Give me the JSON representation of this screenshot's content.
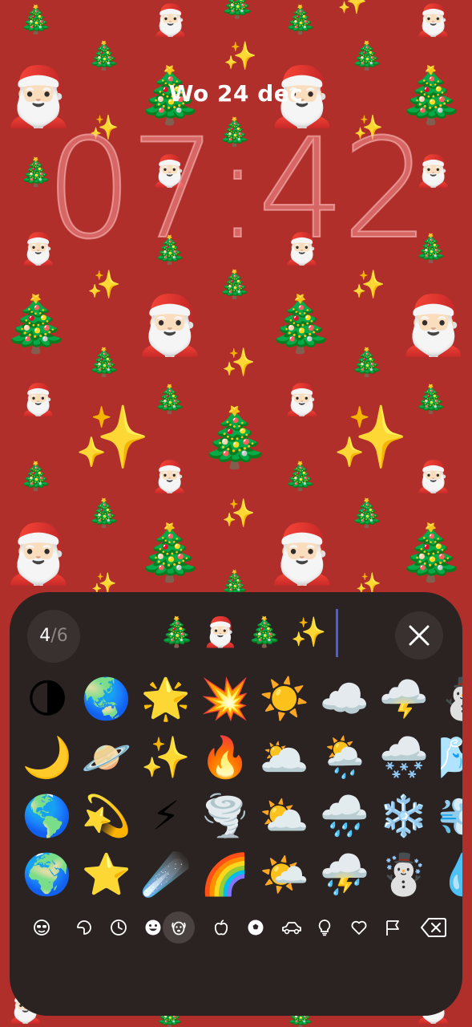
{
  "lock_screen": {
    "date": "Wo 24 dec",
    "time": "07:42"
  },
  "wallpaper": {
    "background_color": "#b12f2a",
    "emojis": [
      "🎅🏻",
      "🎄",
      "✨"
    ]
  },
  "emoji_picker": {
    "counter": {
      "current": "4",
      "total": "/6"
    },
    "selected_emojis": [
      "🎄",
      "🎅🏻",
      "🎄",
      "✨"
    ],
    "grid": [
      [
        "🌗",
        "🌏",
        "🌟",
        "💥",
        "☀️",
        "☁️",
        "🌩️",
        "⛄"
      ],
      [
        "🌙",
        "🪐",
        "✨",
        "🔥",
        "🌥️",
        "🌦️",
        "🌨️",
        "🌬️"
      ],
      [
        "🌎",
        "💫",
        "⚡",
        "🌪️",
        "⛅",
        "🌧️",
        "❄️",
        "💨"
      ],
      [
        "🌍",
        "⭐",
        "☄️",
        "🌈",
        "🌤️",
        "⛈️",
        "☃️",
        "💧"
      ]
    ],
    "categories": [
      {
        "name": "memoji",
        "icon": "memoji-icon"
      },
      {
        "name": "stickers",
        "icon": "stickers-icon"
      },
      {
        "name": "recent",
        "icon": "clock-icon"
      },
      {
        "name": "smileys",
        "icon": "smiley-icon"
      },
      {
        "name": "animals-nature",
        "icon": "dog-icon",
        "active": true
      },
      {
        "name": "food",
        "icon": "apple-icon"
      },
      {
        "name": "activity",
        "icon": "ball-icon"
      },
      {
        "name": "travel",
        "icon": "car-icon"
      },
      {
        "name": "objects",
        "icon": "lightbulb-icon"
      },
      {
        "name": "symbols",
        "icon": "heart-icon"
      },
      {
        "name": "flags",
        "icon": "flag-icon"
      }
    ],
    "colors": {
      "panel": "#2a2322",
      "button": "#383130",
      "caret": "#4a5fe0",
      "active_category": "#4a4240"
    }
  }
}
